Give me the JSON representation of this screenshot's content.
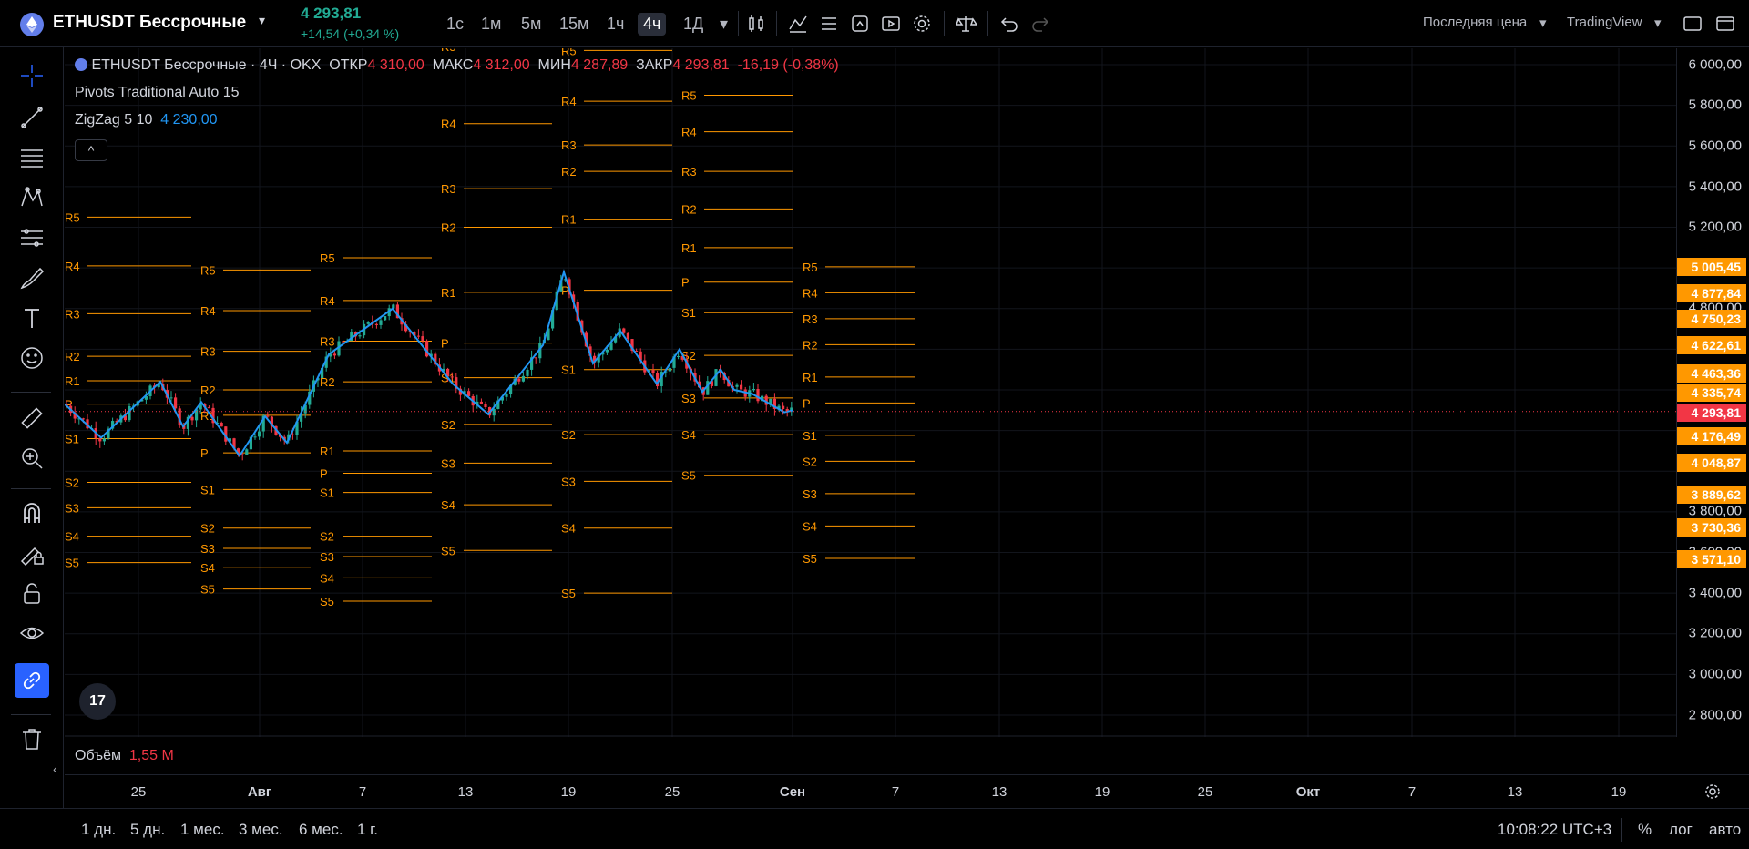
{
  "header": {
    "symbol": "ETHUSDT Бессрочные",
    "price": "4 293,81",
    "change": "+14,54 (+0,34 %)",
    "timeframes": [
      "1с",
      "1м",
      "5м",
      "15м",
      "1ч",
      "4ч",
      "1Д"
    ],
    "active_timeframe": "4ч",
    "price_type": "Последняя цена",
    "broker": "TradingView",
    "icons": [
      "candles-icon",
      "indicators-icon",
      "templates-icon",
      "alert-icon",
      "replay-icon",
      "settings-icon",
      "scales-icon",
      "undo-icon",
      "redo-icon",
      "fullscreen-icon"
    ]
  },
  "left_toolbar": {
    "icons": [
      "crosshair-icon",
      "trendline-icon",
      "fib-icon",
      "pattern-icon",
      "prediction-icon",
      "brush-icon",
      "text-icon",
      "emoji-icon",
      "ruler-icon",
      "zoom-icon",
      "magnet-icon",
      "lock-drawing-icon",
      "lock-icon",
      "eye-icon",
      "link-icon",
      "trash-icon"
    ]
  },
  "legend": {
    "title": "ETHUSDT Бессрочные · 4Ч · OKX",
    "open_label": "ОТКР",
    "open": "4 310,00",
    "high_label": "МАКС",
    "high": "4 312,00",
    "low_label": "МИН",
    "low": "4 287,89",
    "close_label": "ЗАКР",
    "close": "4 293,81",
    "change": "-16,19 (-0,38%)",
    "pivots": "Pivots Traditional Auto 15",
    "zigzag": "ZigZag 5 10",
    "zigzag_value": "4 230,00",
    "collapse": "^",
    "logo": "17",
    "volume_label": "Объём",
    "volume_value": "1,55 M"
  },
  "price_axis": {
    "labels": [
      "6 000,00",
      "5 800,00",
      "5 600,00",
      "5 400,00",
      "5 200,00",
      "4 800,00",
      "3 800,00",
      "3 600,00",
      "3 400,00",
      "3 200,00",
      "3 000,00",
      "2 800,00"
    ],
    "tags": [
      {
        "value": "5 005,45",
        "color": "#ff9800"
      },
      {
        "value": "4 877,84",
        "color": "#ff9800"
      },
      {
        "value": "4 750,23",
        "color": "#ff9800"
      },
      {
        "value": "4 622,61",
        "color": "#ff9800"
      },
      {
        "value": "4 463,36",
        "color": "#ff9800"
      },
      {
        "value": "4 335,74",
        "color": "#ff9800"
      },
      {
        "value": "4 293,81",
        "color": "#f23645"
      },
      {
        "value": "4 176,49",
        "color": "#ff9800"
      },
      {
        "value": "4 048,87",
        "color": "#ff9800"
      },
      {
        "value": "3 889,62",
        "color": "#ff9800"
      },
      {
        "value": "3 730,36",
        "color": "#ff9800"
      },
      {
        "value": "3 571,10",
        "color": "#ff9800"
      }
    ]
  },
  "time_axis": {
    "labels": [
      "25",
      "Авг",
      "7",
      "13",
      "19",
      "25",
      "Сен",
      "7",
      "13",
      "19",
      "25",
      "Окт",
      "7",
      "13",
      "19"
    ],
    "major": [
      "Авг",
      "Сен",
      "Окт"
    ]
  },
  "bottom": {
    "ranges": [
      "1 дн.",
      "5 дн.",
      "1 мес.",
      "3 мес.",
      "6 мес.",
      "1 г."
    ],
    "time": "10:08:22 UTC+3",
    "percent": "%",
    "log": "лог",
    "auto": "авто"
  },
  "pivot_labels": [
    "R5",
    "R4",
    "R3",
    "R2",
    "R1",
    "P",
    "S1",
    "S2",
    "S3",
    "S4",
    "S5"
  ],
  "colors": {
    "up": "#22ab94",
    "down": "#f23645",
    "pivot": "#ff9800",
    "zigzag": "#2196f3",
    "accent": "#2962ff"
  }
}
